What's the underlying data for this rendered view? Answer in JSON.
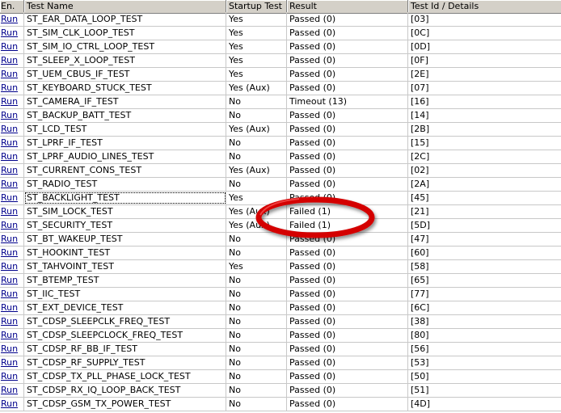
{
  "columns": [
    "En.",
    "Test Name",
    "Startup Test",
    "Result",
    "Test Id / Details"
  ],
  "run_label": "Run",
  "rows": [
    {
      "name": "ST_EAR_DATA_LOOP_TEST",
      "startup": "Yes",
      "result": "Passed (0)",
      "id": "[03]"
    },
    {
      "name": "ST_SIM_CLK_LOOP_TEST",
      "startup": "Yes",
      "result": "Passed (0)",
      "id": "[0C]"
    },
    {
      "name": "ST_SIM_IO_CTRL_LOOP_TEST",
      "startup": "Yes",
      "result": "Passed (0)",
      "id": "[0D]"
    },
    {
      "name": "ST_SLEEP_X_LOOP_TEST",
      "startup": "Yes",
      "result": "Passed (0)",
      "id": "[0F]"
    },
    {
      "name": "ST_UEM_CBUS_IF_TEST",
      "startup": "Yes",
      "result": "Passed (0)",
      "id": "[2E]"
    },
    {
      "name": "ST_KEYBOARD_STUCK_TEST",
      "startup": "Yes (Aux)",
      "result": "Passed (0)",
      "id": "[07]"
    },
    {
      "name": "ST_CAMERA_IF_TEST",
      "startup": "No",
      "result": "Timeout (13)",
      "id": "[16]"
    },
    {
      "name": "ST_BACKUP_BATT_TEST",
      "startup": "No",
      "result": "Passed (0)",
      "id": "[14]"
    },
    {
      "name": "ST_LCD_TEST",
      "startup": "Yes (Aux)",
      "result": "Passed (0)",
      "id": "[2B]"
    },
    {
      "name": "ST_LPRF_IF_TEST",
      "startup": "No",
      "result": "Passed (0)",
      "id": "[15]"
    },
    {
      "name": "ST_LPRF_AUDIO_LINES_TEST",
      "startup": "No",
      "result": "Passed (0)",
      "id": "[2C]"
    },
    {
      "name": "ST_CURRENT_CONS_TEST",
      "startup": "Yes (Aux)",
      "result": "Passed (0)",
      "id": "[02]"
    },
    {
      "name": "ST_RADIO_TEST",
      "startup": "No",
      "result": "Passed (0)",
      "id": "[2A]"
    },
    {
      "name": "ST_BACKLIGHT_TEST",
      "startup": "Yes",
      "result": "Passed (0)",
      "id": "[45]"
    },
    {
      "name": "ST_SIM_LOCK_TEST",
      "startup": "Yes (Aux)",
      "result": "Failed (1)",
      "id": "[21]"
    },
    {
      "name": "ST_SECURITY_TEST",
      "startup": "Yes (Aux)",
      "result": "Failed (1)",
      "id": "[5D]"
    },
    {
      "name": "ST_BT_WAKEUP_TEST",
      "startup": "No",
      "result": "Passed (0)",
      "id": "[47]"
    },
    {
      "name": "ST_HOOKINT_TEST",
      "startup": "No",
      "result": "Passed (0)",
      "id": "[60]"
    },
    {
      "name": "ST_TAHVOINT_TEST",
      "startup": "Yes",
      "result": "Passed (0)",
      "id": "[58]"
    },
    {
      "name": "ST_BTEMP_TEST",
      "startup": "No",
      "result": "Passed (0)",
      "id": "[65]"
    },
    {
      "name": "ST_IIC_TEST",
      "startup": "No",
      "result": "Passed (0)",
      "id": "[77]"
    },
    {
      "name": "ST_EXT_DEVICE_TEST",
      "startup": "No",
      "result": "Passed (0)",
      "id": "[6C]"
    },
    {
      "name": "ST_CDSP_SLEEPCLK_FREQ_TEST",
      "startup": "No",
      "result": "Passed (0)",
      "id": "[38]"
    },
    {
      "name": "ST_CDSP_SLEEPCLOCK_FREQ_TEST",
      "startup": "No",
      "result": "Passed (0)",
      "id": "[80]"
    },
    {
      "name": "ST_CDSP_RF_BB_IF_TEST",
      "startup": "No",
      "result": "Passed (0)",
      "id": "[56]"
    },
    {
      "name": "ST_CDSP_RF_SUPPLY_TEST",
      "startup": "No",
      "result": "Passed (0)",
      "id": "[53]"
    },
    {
      "name": "ST_CDSP_TX_PLL_PHASE_LOCK_TEST",
      "startup": "No",
      "result": "Passed (0)",
      "id": "[50]"
    },
    {
      "name": "ST_CDSP_RX_IQ_LOOP_BACK_TEST",
      "startup": "No",
      "result": "Passed (0)",
      "id": "[51]"
    },
    {
      "name": "ST_CDSP_GSM_TX_POWER_TEST",
      "startup": "No",
      "result": "Passed (0)",
      "id": "[4D]"
    }
  ],
  "focused_row": 13,
  "highlight_color": "#d40000"
}
